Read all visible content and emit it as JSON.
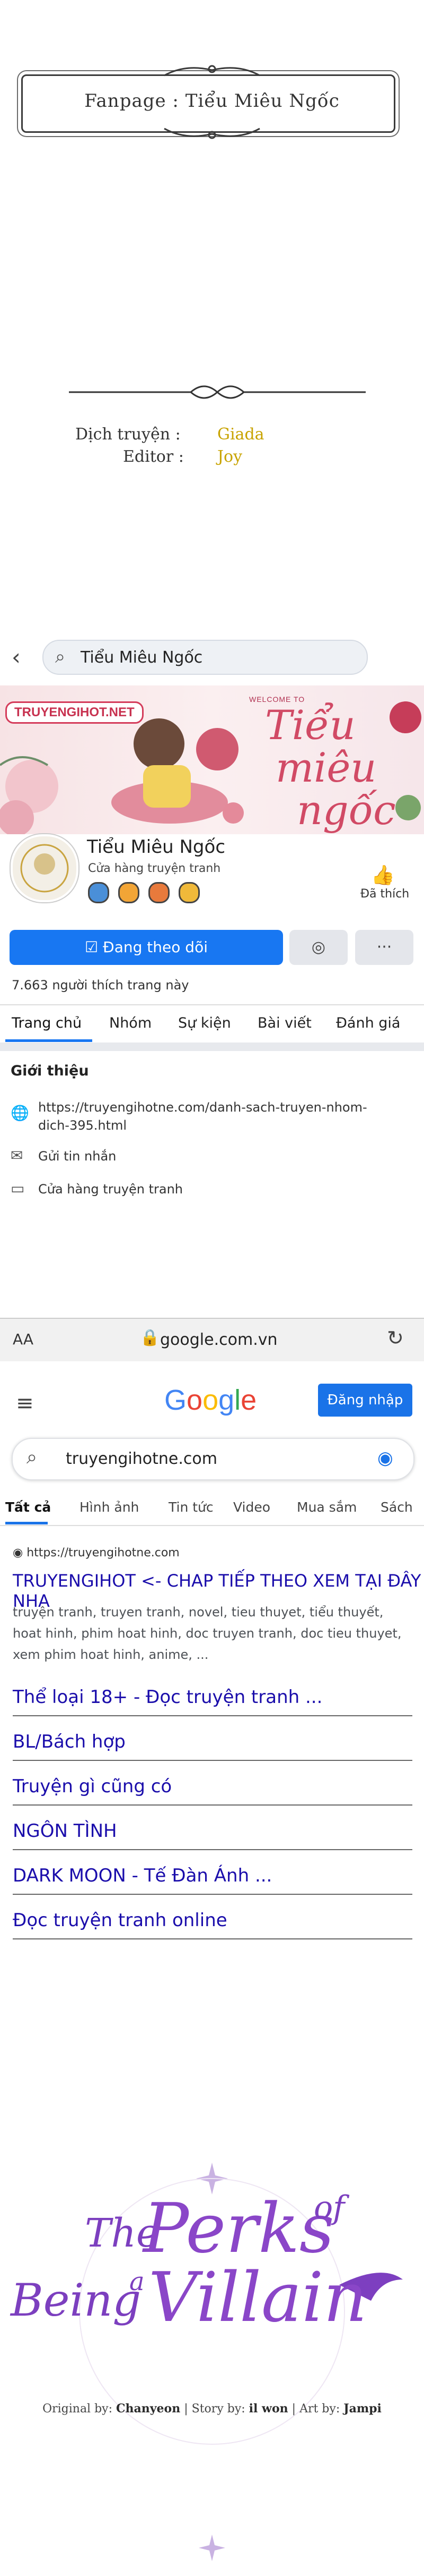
{
  "credits_card": {
    "fanpage": "Fanpage : Tiểu Miêu Ngốc",
    "translator_label": "Dịch truyện :",
    "translator_value": "Giada",
    "editor_label": "Editor :",
    "editor_value": "Joy"
  },
  "facebook": {
    "search_text": "Tiểu Miêu Ngốc",
    "cover": {
      "site": "TRUYENGIHOT.NET",
      "welcome": "WELCOME TO",
      "title_line1": "Tiểu",
      "title_line2": "miêu",
      "title_line3": "ngốc"
    },
    "page_name": "Tiểu Miêu Ngốc",
    "category": "Cửa hàng truyện tranh",
    "like_label": "Đã thích",
    "follow_button": "Đang theo dõi",
    "likes_count": "7.663 người thích trang này",
    "tabs": [
      "Trang chủ",
      "Nhóm",
      "Sự kiện",
      "Bài viết",
      "Đánh giá"
    ],
    "intro_heading": "Giới thiệu",
    "intro_link_line1": "https://truyengihotne.com/danh-sach-truyen-nhom-",
    "intro_link_line2": "dich-395.html",
    "send_message": "Gửi tin nhắn",
    "shop": "Cửa hàng truyện tranh",
    "browser": {
      "aa": "AA",
      "url": "google.com.vn"
    }
  },
  "google": {
    "logo_letters": [
      "G",
      "o",
      "o",
      "g",
      "l",
      "e"
    ],
    "logo_colors": [
      "#4285F4",
      "#EA4335",
      "#FBBC05",
      "#4285F4",
      "#34A853",
      "#EA4335"
    ],
    "login": "Đăng nhập",
    "query": "truyengihotne.com",
    "tabs": [
      "Tất cả",
      "Hình ảnh",
      "Tin tức",
      "Video",
      "Mua sắm",
      "Sách"
    ],
    "result_url": "https://truyengihotne.com",
    "result_title": "TRUYENGIHOT <- CHAP TIẾP THEO XEM TẠI ĐÂY NHA",
    "result_snippet": "truyện tranh, truyen tranh, novel, tieu thuyet, tiểu thuyết, hoat hinh, phim hoat hinh, doc truyen tranh, doc tieu thuyet, xem phim hoat hinh, anime, ...",
    "sitelinks": [
      "Thể loại 18+ - Đọc truyện tranh ...",
      "BL/Bách hợp",
      "Truyện gì cũng có",
      "NGÔN TÌNH",
      "DARK MOON - Tế Đàn Ánh ...",
      "Đọc truyện tranh online"
    ]
  },
  "series_logo": {
    "the": "The",
    "perks": "Perks",
    "of": "of",
    "being": "Being",
    "a": "a",
    "villain": "Villain",
    "original_label": "Original by:",
    "original_value": "Chanyeon",
    "story_label": "Story by:",
    "story_value": "il won",
    "art_label": "Art by:",
    "art_value": "Jampi"
  },
  "icons": {
    "back": "back-arrow-icon",
    "search": "search-icon",
    "like": "thumbs-up-icon",
    "messenger": "messenger-icon",
    "more": "more-icon",
    "globe": "globe-icon",
    "message": "message-icon",
    "shop": "shop-icon",
    "lock": "lock-icon",
    "reload": "reload-icon",
    "menu": "hamburger-menu-icon",
    "camera": "camera-search-icon"
  }
}
